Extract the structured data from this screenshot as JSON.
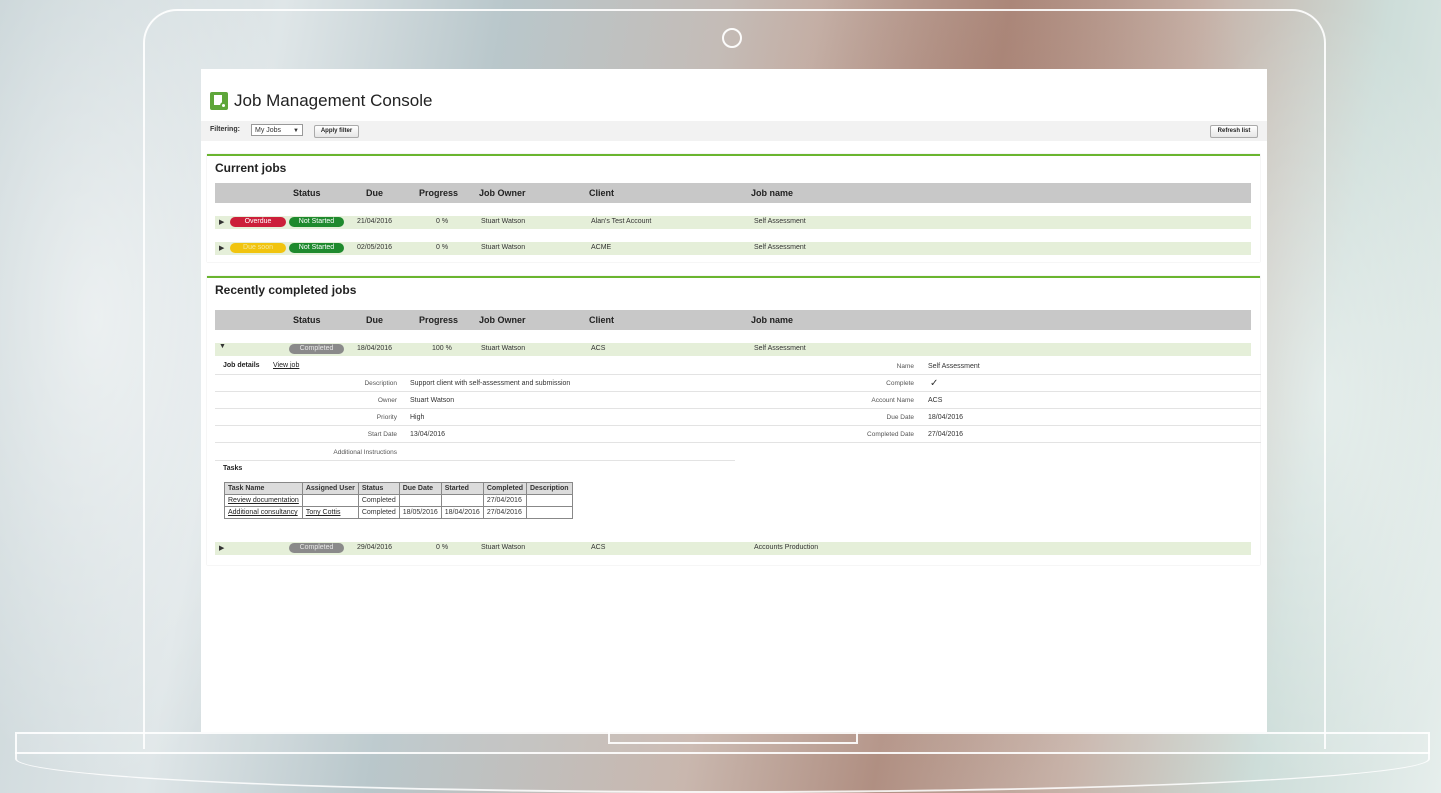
{
  "app": {
    "title": "Job Management Console"
  },
  "filter": {
    "label": "Filtering:",
    "value": "My Jobs",
    "apply_label": "Apply filter",
    "refresh_label": "Refresh list"
  },
  "columns": {
    "status": "Status",
    "due": "Due",
    "progress": "Progress",
    "owner": "Job Owner",
    "client": "Client",
    "name": "Job name"
  },
  "colors": {
    "accent": "#6ab52f",
    "overdue": "#cc1f3a",
    "due_soon": "#f1c40f",
    "not_started": "#1f8a2e",
    "completed": "#8a8a8a",
    "row": "#e5efd9"
  },
  "current": {
    "title": "Current jobs",
    "rows": [
      {
        "badge": "Overdue",
        "state": "Not Started",
        "due": "21/04/2016",
        "progress": "0 %",
        "owner": "Stuart Watson",
        "client": "Alan's Test Account",
        "name": "Self Assessment"
      },
      {
        "badge": "Due soon",
        "state": "Not Started",
        "due": "02/05/2016",
        "progress": "0 %",
        "owner": "Stuart Watson",
        "client": "ACME",
        "name": "Self Assessment"
      }
    ]
  },
  "completed": {
    "title": "Recently completed jobs",
    "rows": [
      {
        "state": "Completed",
        "due": "18/04/2016",
        "progress": "100 %",
        "owner": "Stuart Watson",
        "client": "ACS",
        "name": "Self Assessment"
      },
      {
        "state": "Completed",
        "due": "29/04/2016",
        "progress": "0 %",
        "owner": "Stuart Watson",
        "client": "ACS",
        "name": "Accounts Production"
      }
    ]
  },
  "details": {
    "heading": "Job details",
    "view_link": "View job",
    "left": [
      {
        "label": "Description",
        "value": "Support client with self-assessment and submission"
      },
      {
        "label": "Owner",
        "value": "Stuart Watson"
      },
      {
        "label": "Priority",
        "value": "High"
      },
      {
        "label": "Start Date",
        "value": "13/04/2016"
      },
      {
        "label": "Additional Instructions",
        "value": ""
      }
    ],
    "right": [
      {
        "label": "Name",
        "value": "Self Assessment"
      },
      {
        "label": "Complete",
        "value": "✓"
      },
      {
        "label": "Account Name",
        "value": "ACS"
      },
      {
        "label": "Due Date",
        "value": "18/04/2016"
      },
      {
        "label": "Completed Date",
        "value": "27/04/2016"
      }
    ],
    "tasks_heading": "Tasks",
    "task_columns": [
      "Task Name",
      "Assigned User",
      "Status",
      "Due Date",
      "Started",
      "Completed",
      "Description"
    ],
    "tasks": [
      [
        "Review documentation",
        "",
        "Completed",
        "",
        "",
        "27/04/2016",
        ""
      ],
      [
        "Additional consultancy",
        "Tony Cottis",
        "Completed",
        "18/05/2016",
        "18/04/2016",
        "27/04/2016",
        ""
      ]
    ]
  }
}
